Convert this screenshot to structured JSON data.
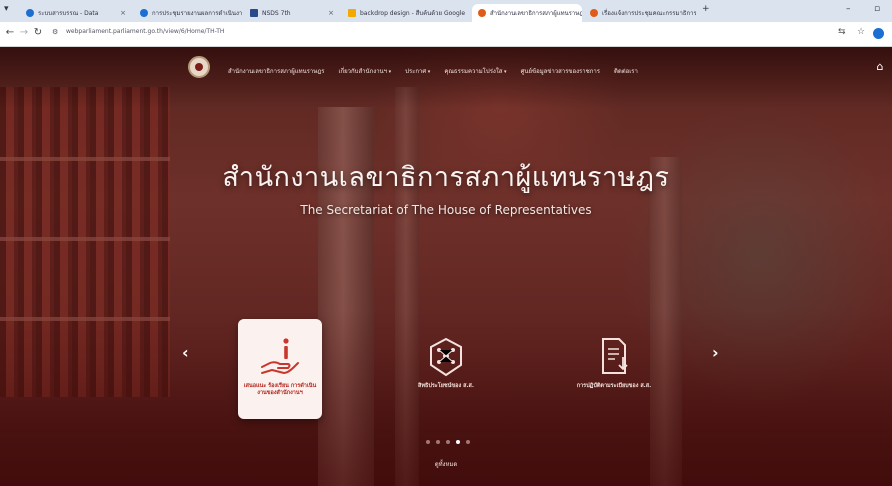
{
  "browser": {
    "tabs": [
      {
        "title": "ระบบสารบรรณ - Data",
        "color": "#1b6fd1"
      },
      {
        "title": "การประชุมรายงานผลการดำเนินงาน",
        "color": "#1b6fd1"
      },
      {
        "title": "NSDS 7th",
        "color": "#2b4a8c"
      },
      {
        "title": "backdrop design - สืบค้นด้วย Google",
        "color": "#f2a900"
      },
      {
        "title": "สำนักงานเลขาธิการสภาผู้แทนราษฎร",
        "color": "#e05a1a"
      },
      {
        "title": "เรื่องแจ้งการประชุมคณะกรรมาธิการ",
        "color": "#e05a1a"
      }
    ],
    "new_tab": "+",
    "url": "webparliament.parliament.go.th/view/6/Home/TH-TH"
  },
  "nav": {
    "items": [
      {
        "label": "สำนักงานเลขาธิการสภาผู้แทนราษฎร",
        "caret": false
      },
      {
        "label": "เกี่ยวกับสำนักงานฯ",
        "caret": true
      },
      {
        "label": "ประกาศ",
        "caret": true
      },
      {
        "label": "คุณธรรมความโปร่งใส",
        "caret": true
      },
      {
        "label": "ศูนย์ข้อมูลข่าวสารของราชการ",
        "caret": false
      },
      {
        "label": "ติดต่อเรา",
        "caret": false
      }
    ]
  },
  "hero": {
    "title": "สำนักงานเลขาธิการสภาผู้แทนราษฎร",
    "subtitle": "The Secretariat of The House of Representatives"
  },
  "cards": [
    {
      "label": "เสนอแนะ ร้องเรียน การดำเนินงานของสำนักงานฯ",
      "icon": "hand-info-icon",
      "active": true
    },
    {
      "label": "สิทธิประโยชน์ของ ส.ส.",
      "icon": "hexagon-network-icon",
      "active": false
    },
    {
      "label": "การปฏิบัติตามระเบียบของ ส.ส.",
      "icon": "document-download-icon",
      "active": false
    }
  ],
  "carousel": {
    "prev": "‹",
    "next": "›",
    "page_count": 5,
    "active_dot_index": 3
  },
  "view_all": "ดูทั้งหมด",
  "colors": {
    "brand": "#7a1e18",
    "accent": "#b3261e"
  }
}
